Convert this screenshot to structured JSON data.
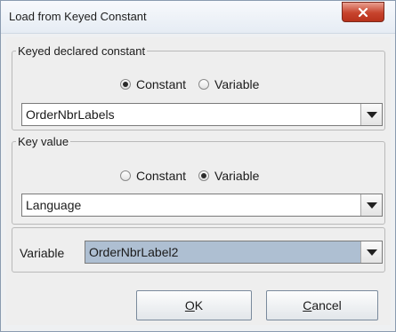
{
  "window": {
    "title": "Load from Keyed Constant"
  },
  "keyed_group": {
    "legend": "Keyed declared constant",
    "radio_constant": "Constant",
    "radio_variable": "Variable",
    "selected": "Constant",
    "combo_value": "OrderNbrLabels"
  },
  "key_group": {
    "legend": "Key value",
    "radio_constant": "Constant",
    "radio_variable": "Variable",
    "selected": "Variable",
    "combo_value": "Language"
  },
  "variable": {
    "label": "Variable",
    "value": "OrderNbrLabel2"
  },
  "buttons": {
    "ok": "OK",
    "cancel": "Cancel"
  },
  "icons": {
    "close": "close-icon",
    "dropdown": "chevron-down-icon"
  }
}
